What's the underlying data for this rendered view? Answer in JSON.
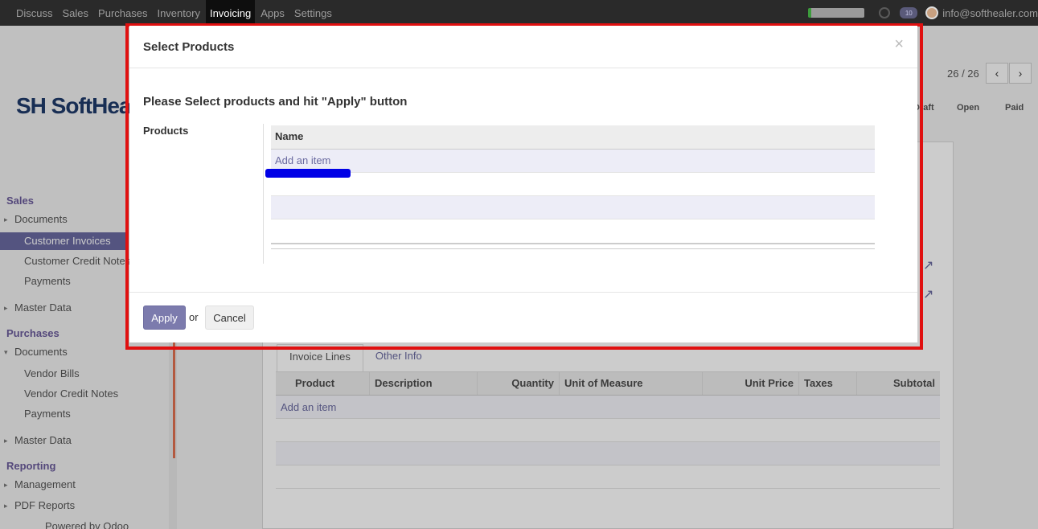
{
  "navbar": {
    "menu": [
      "Discuss",
      "Sales",
      "Purchases",
      "Inventory",
      "Invoicing",
      "Apps",
      "Settings"
    ],
    "active": "Invoicing",
    "chat_count": "10",
    "user_email": "info@softhealer.com"
  },
  "sidebar": {
    "logo_text": "SH SoftHea",
    "sections": [
      {
        "title": "Sales",
        "items": [
          {
            "label": "Documents",
            "level": 1,
            "caret": "▸"
          },
          {
            "label": "Customer Invoices",
            "level": 2,
            "active": true
          },
          {
            "label": "Customer Credit Notes",
            "level": 2
          },
          {
            "label": "Payments",
            "level": 2
          },
          {
            "label": "Master Data",
            "level": 1,
            "caret": "▸"
          }
        ]
      },
      {
        "title": "Purchases",
        "items": [
          {
            "label": "Documents",
            "level": 1,
            "caret": "▾"
          },
          {
            "label": "Vendor Bills",
            "level": 2
          },
          {
            "label": "Vendor Credit Notes",
            "level": 2
          },
          {
            "label": "Payments",
            "level": 2
          },
          {
            "label": "Master Data",
            "level": 1,
            "caret": "▸"
          }
        ]
      },
      {
        "title": "Reporting",
        "items": [
          {
            "label": "Management",
            "level": 1,
            "caret": "▸"
          },
          {
            "label": "PDF Reports",
            "level": 1,
            "caret": "▸"
          }
        ]
      }
    ],
    "footer": "Powered by Odoo"
  },
  "record": {
    "pager": "26 / 26",
    "statuses": [
      "Draft",
      "Open",
      "Paid"
    ],
    "tabs": [
      "Invoice Lines",
      "Other Info"
    ],
    "lines_columns": [
      "Product",
      "Description",
      "Quantity",
      "Unit of Measure",
      "Unit Price",
      "Taxes",
      "Subtotal"
    ],
    "add_item": "Add an item"
  },
  "modal": {
    "title": "Select Products",
    "close": "×",
    "instruction": "Please Select products and hit \"Apply\" button",
    "field_label": "Products",
    "column_name": "Name",
    "add_item": "Add an item",
    "apply_label": "Apply",
    "or_text": "or",
    "cancel_label": "Cancel"
  },
  "colors": {
    "highlight": "#e01010",
    "primary": "#7c7bad",
    "annotation": "#0000e6"
  }
}
